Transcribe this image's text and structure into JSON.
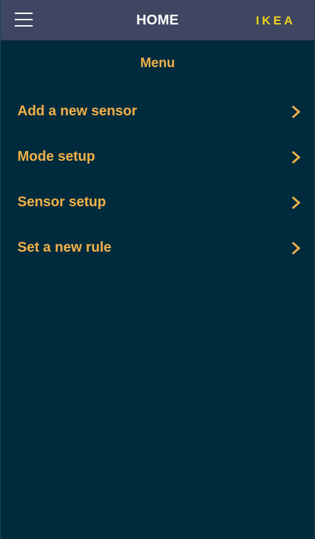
{
  "header": {
    "title": "HOME",
    "menu_icon": "hamburger-icon",
    "logo_text": "IKEA"
  },
  "menu": {
    "heading": "Menu",
    "items": [
      {
        "label": "Add a new sensor",
        "icon": "chevron-right-icon"
      },
      {
        "label": "Mode setup",
        "icon": "chevron-right-icon"
      },
      {
        "label": "Sensor setup",
        "icon": "chevron-right-icon"
      },
      {
        "label": "Set a new rule",
        "icon": "chevron-right-icon"
      }
    ]
  },
  "colors": {
    "background": "#002b3d",
    "header_background": "#3f4662",
    "accent": "#f2b047",
    "logo": "#f1d51a",
    "header_text": "#ffffff"
  }
}
